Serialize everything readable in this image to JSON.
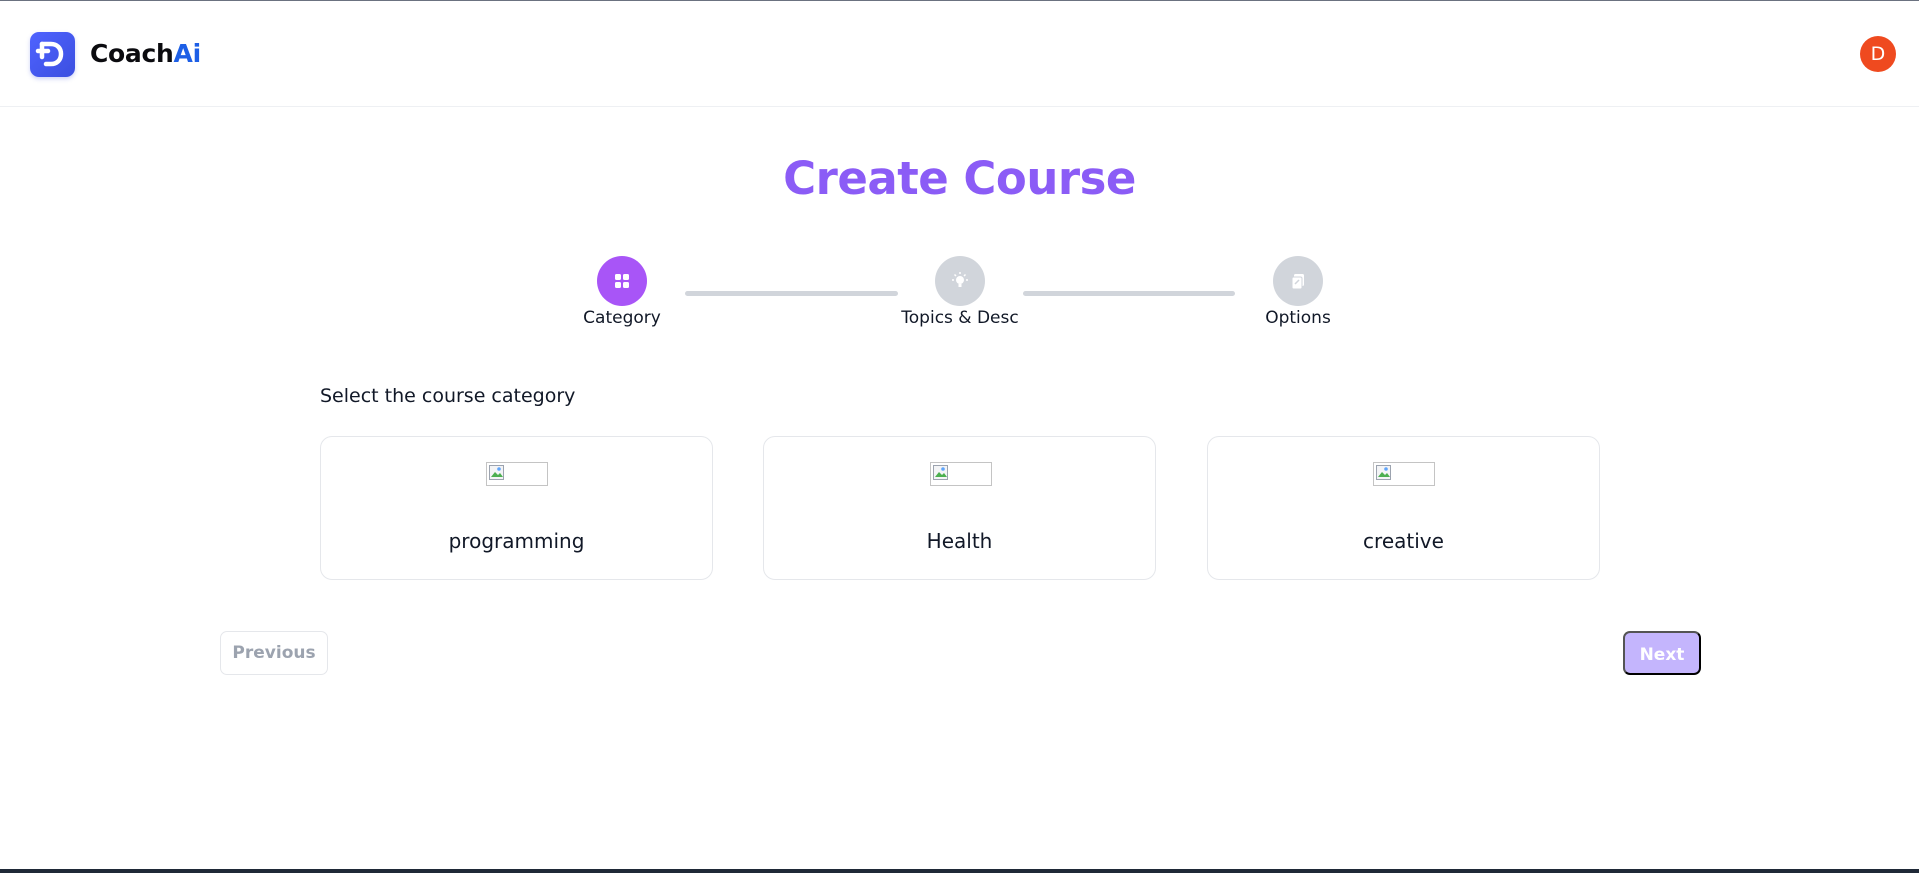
{
  "header": {
    "brand_part1": "Coach",
    "brand_part2": "Ai",
    "avatar_initial": "D",
    "logo_icon": "logo-icon"
  },
  "page": {
    "title": "Create Course"
  },
  "stepper": {
    "steps": [
      {
        "label": "Category",
        "icon": "grid-icon",
        "active": true
      },
      {
        "label": "Topics & Desc",
        "icon": "lightbulb-icon",
        "active": false
      },
      {
        "label": "Options",
        "icon": "clipboard-icon",
        "active": false
      }
    ]
  },
  "category_section": {
    "label": "Select the course category",
    "categories": [
      {
        "label": "programming",
        "icon": "broken-image-icon"
      },
      {
        "label": "Health",
        "icon": "broken-image-icon"
      },
      {
        "label": "creative",
        "icon": "broken-image-icon"
      }
    ]
  },
  "navigation": {
    "previous_label": "Previous",
    "next_label": "Next"
  },
  "colors": {
    "accent": "#8b5cf6",
    "step_active": "#a855f7",
    "step_inactive": "#d1d5db",
    "next_button_disabled": "#c4b5fd",
    "avatar": "#ef4a1f",
    "brand_blue": "#1d5fe6"
  }
}
